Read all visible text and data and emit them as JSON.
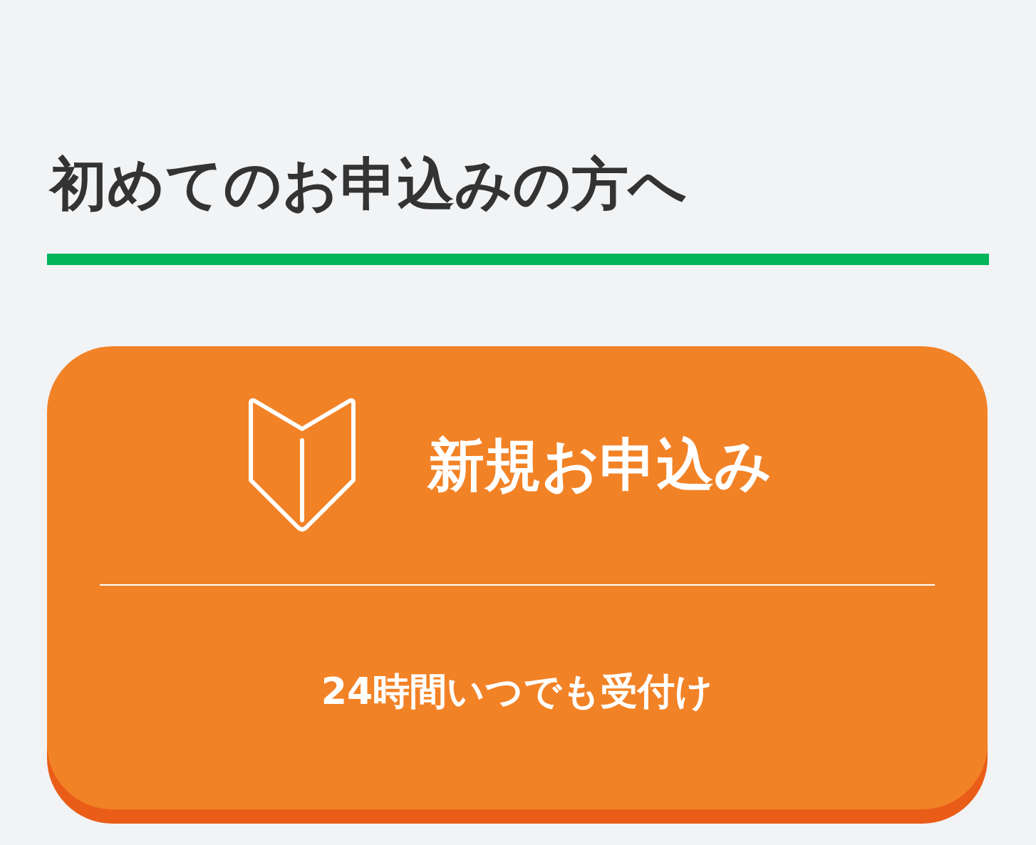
{
  "heading": "初めてのお申込みの方へ",
  "apply_button": {
    "label": "新規お申込み",
    "note": "24時間いつでも受付け"
  }
}
